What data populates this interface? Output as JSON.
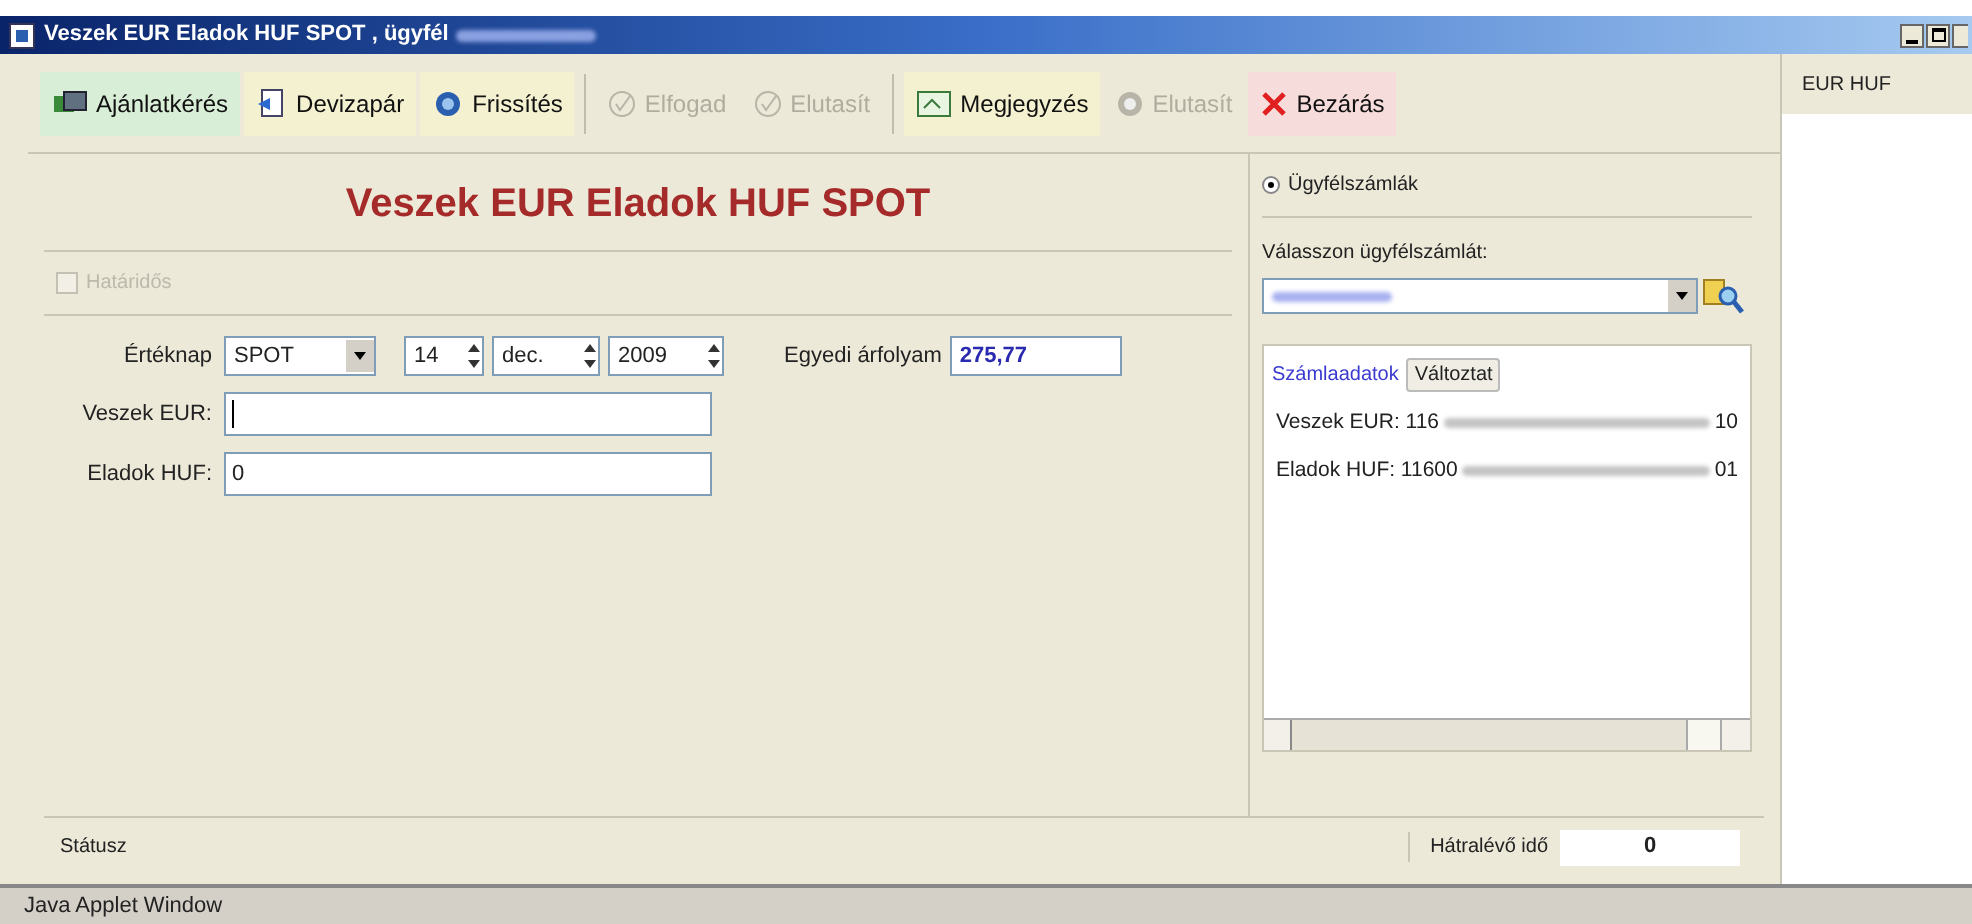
{
  "window": {
    "title": "Veszek EUR Eladok HUF SPOT , ügyfél"
  },
  "toolbar": [
    {
      "label": "Ajánlatkérés",
      "color": "#d9eed6",
      "disabled": false
    },
    {
      "label": "Devizapár",
      "color": "#f4f1d0",
      "disabled": false
    },
    {
      "label": "Frissítés",
      "color": "#f4f1d0",
      "disabled": false
    },
    {
      "label": "Elfogad",
      "color": "#ece9d8",
      "disabled": true
    },
    {
      "label": "Elutasít",
      "color": "#ece9d8",
      "disabled": true
    },
    {
      "label": "Megjegyzés",
      "color": "#f4f1d0",
      "disabled": false
    },
    {
      "label": "Elutasít",
      "color": "#ece9d8",
      "disabled": true
    },
    {
      "label": "Bezárás",
      "color": "#f7dcdc",
      "disabled": false
    }
  ],
  "heading": "Veszek EUR Eladok HUF SPOT",
  "deadline_checkbox": {
    "label": "Határidős",
    "checked": false,
    "disabled": true
  },
  "value_date": {
    "label": "Értéknap",
    "type": "SPOT",
    "day": "14",
    "month": "dec.",
    "year": "2009"
  },
  "custom_rate": {
    "label": "Egyedi árfolyam",
    "value": "275,77"
  },
  "buy": {
    "label": "Veszek EUR:"
  },
  "sell": {
    "label": "Eladok HUF:",
    "value": "0"
  },
  "accounts": {
    "radio": {
      "label": "Ügyfélszámlák",
      "selected": true
    },
    "prompt": "Válasszon ügyfélszámlát:",
    "tab": "Számlaadatok",
    "change_button": "Változtat",
    "lines": [
      {
        "prefix": "Veszek EUR: 116",
        "suffix": "10"
      },
      {
        "prefix": "Eladok HUF: 11600",
        "suffix": "01"
      }
    ]
  },
  "status_bar": {
    "label": "Státusz",
    "remaining_label": "Hátralévő idő",
    "remaining": "0"
  },
  "side_panel": {
    "title": "EUR HUF"
  },
  "applet_bar": "Java Applet Window"
}
